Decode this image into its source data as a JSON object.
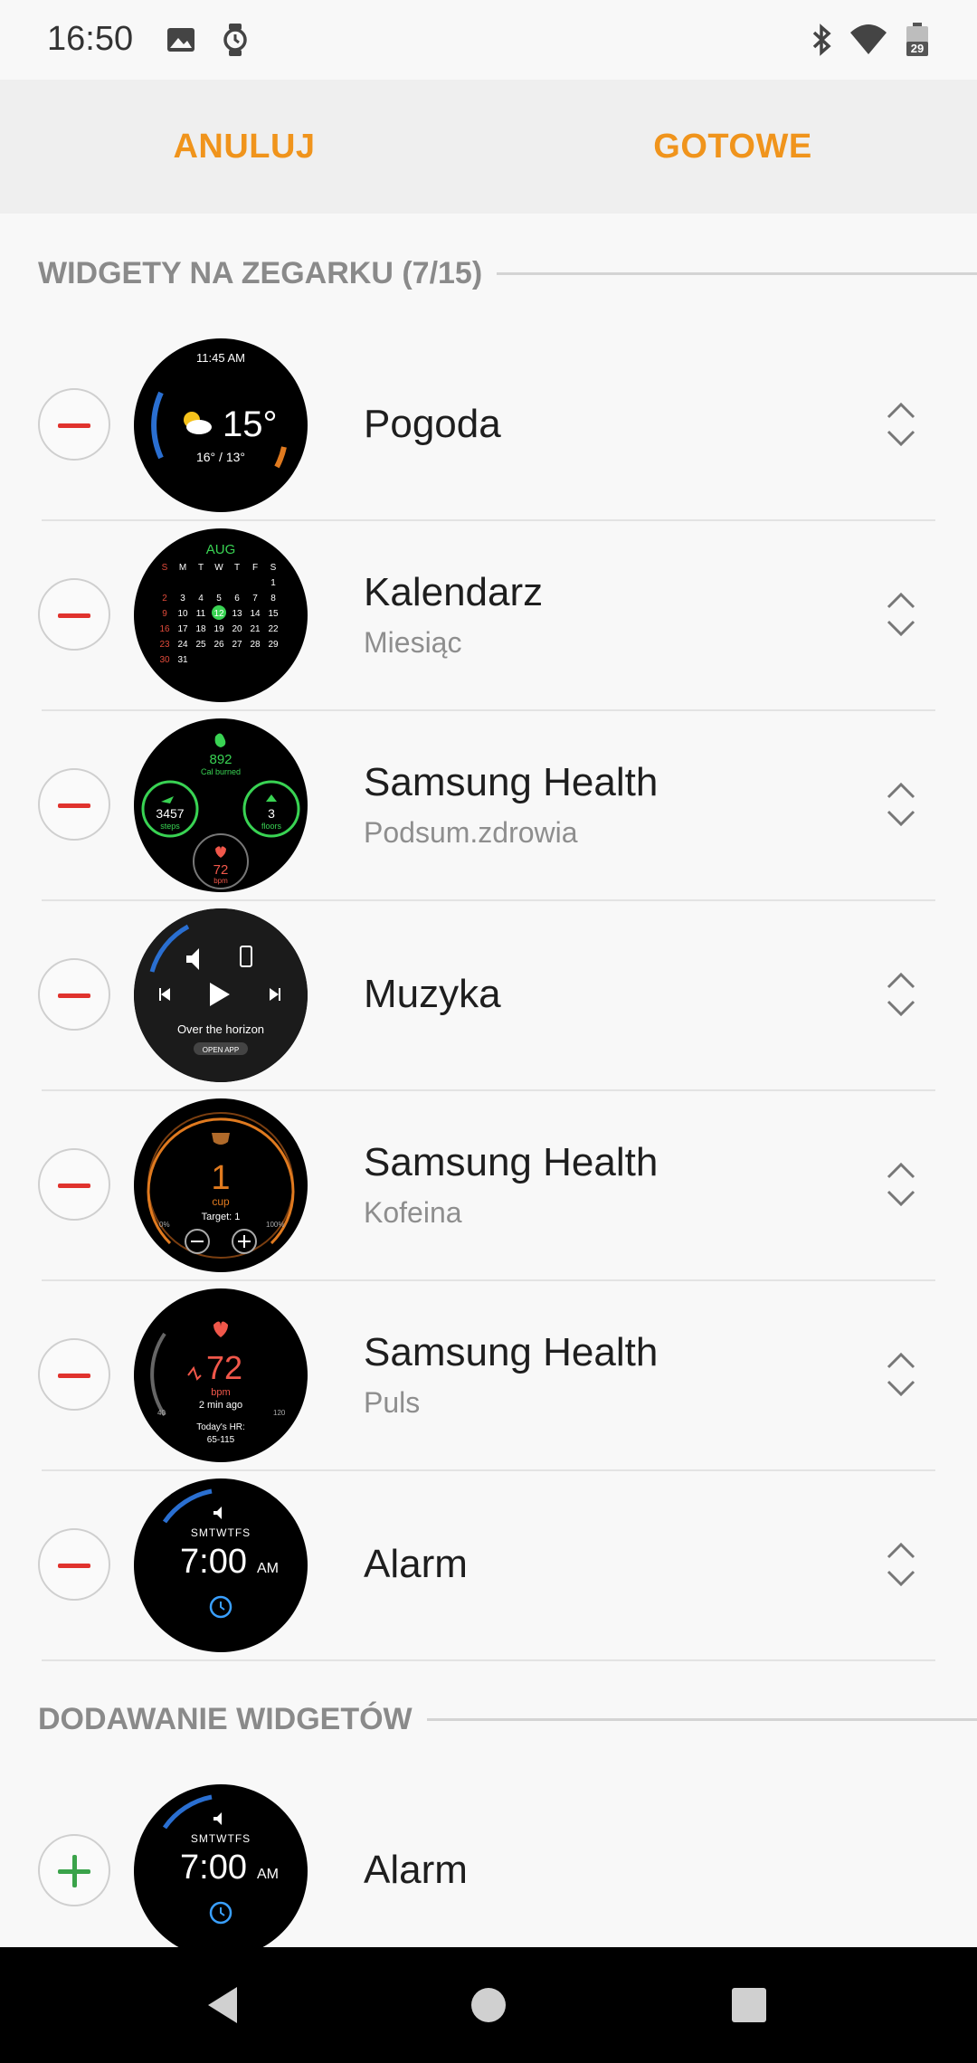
{
  "status_bar": {
    "time": "16:50",
    "left_icons": [
      "image-icon",
      "watch-icon"
    ],
    "right_icons": [
      "bluetooth-icon",
      "wifi-icon",
      "battery-icon"
    ],
    "battery_level": "29"
  },
  "action_bar": {
    "cancel_label": "ANULUJ",
    "done_label": "GOTOWE",
    "accent_color": "#f0941c"
  },
  "sections": {
    "on_watch_title": "WIDGETY NA ZEGARKU (7/15)",
    "add_title": "DODAWANIE WIDGETÓW"
  },
  "widgets_on_watch": [
    {
      "name": "Pogoda",
      "subtitle": "",
      "preview": {
        "time": "11:45 AM",
        "temp": "15°",
        "range": "16° / 13°"
      }
    },
    {
      "name": "Kalendarz",
      "subtitle": "Miesiąc",
      "preview": {
        "month": "AUG",
        "weekdays": [
          "S",
          "M",
          "T",
          "W",
          "T",
          "F",
          "S"
        ]
      }
    },
    {
      "name": "Samsung Health",
      "subtitle": "Podsum.zdrowia",
      "preview": {
        "cal": "892",
        "cal_label": "Cal burned",
        "steps": "3457",
        "steps_label": "steps",
        "floors": "3",
        "floors_label": "floors",
        "bpm": "72",
        "bpm_label": "bpm"
      }
    },
    {
      "name": "Muzyka",
      "subtitle": "",
      "preview": {
        "title": "Over the horizon",
        "button": "OPEN APP"
      }
    },
    {
      "name": "Samsung Health",
      "subtitle": "Kofeina",
      "preview": {
        "value": "1",
        "unit": "cup",
        "target": "Target: 1",
        "min": "0%",
        "max": "100%"
      }
    },
    {
      "name": "Samsung Health",
      "subtitle": "Puls",
      "preview": {
        "value": "72",
        "unit": "bpm",
        "ago": "2 min ago",
        "today": "Today's HR:",
        "range": "65-115",
        "scale_min": "40",
        "scale_max": "120"
      }
    },
    {
      "name": "Alarm",
      "subtitle": "",
      "preview": {
        "days": "SMTWTFS",
        "time": "7:00",
        "ampm": "AM"
      }
    }
  ],
  "widgets_to_add": [
    {
      "name": "Alarm",
      "subtitle": "",
      "preview": {
        "days": "SMTWTFS",
        "time": "7:00",
        "ampm": "AM"
      }
    }
  ],
  "navigation": {
    "buttons": [
      "back-icon",
      "home-icon",
      "recents-icon"
    ]
  }
}
